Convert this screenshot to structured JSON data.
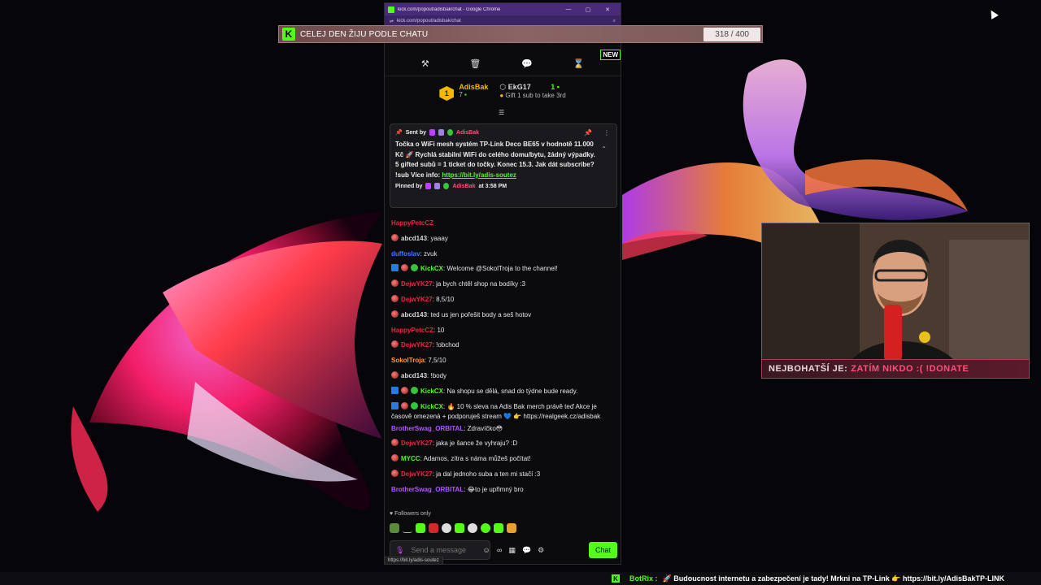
{
  "browser": {
    "window_title": "kick.com/popout/adisbak/chat - Google Chrome",
    "url": "kick.com/popout/adisbak/chat",
    "status_url": "https://bit.ly/adis-soutez"
  },
  "goal": {
    "text": "CELEJ DEN ŽIJU PODLE CHATU",
    "count": "318 / 400"
  },
  "toolbar": {
    "new_badge": "NEW"
  },
  "leaderboard": {
    "rank1": "1",
    "first_name": "AdisBak",
    "first_count": "7",
    "second_name": "EkG17",
    "second_count": "1",
    "second_hint": "Gift 1 sub to take 3rd"
  },
  "pinned": {
    "sent_by": "Sent by",
    "sender": "AdisBak",
    "body": "Točka o WiFi mesh systém TP-Link Deco BE65 v hodnotě 11.000 Kč 🚀 Rychlá stabilní WiFi do celého domu/bytu, žádný výpadky. 5 gifted subů = 1 ticket do točky. Konec 15.3. Jak dát subscribe? !sub Více info: ",
    "link": "https://bit.ly/adis-soutez",
    "pinned_by": "Pinned by",
    "pinner": "AdisBak",
    "time": "at 3:58 PM"
  },
  "chat": [
    {
      "user": "HappyPetcCZ",
      "color": "#e8263f",
      "text": "",
      "badge": ""
    },
    {
      "user": "abcd143",
      "color": "#d9d9d9",
      "text": ": yaaay",
      "badge": "red"
    },
    {
      "user": "duffoslav",
      "color": "#3d7bff",
      "text": ": zvuk",
      "badge": ""
    },
    {
      "user": "KickCX",
      "color": "#53fc18",
      "text": ": Welcome @SokolTroja to the channel!",
      "badge": "bot"
    },
    {
      "user": "DejwYK27",
      "color": "#e8263f",
      "text": ": ja bych chtěl shop na bodíky :3",
      "badge": "red"
    },
    {
      "user": "DejwYK27",
      "color": "#e8263f",
      "text": ": 8,5/10",
      "badge": "red"
    },
    {
      "user": "abcd143",
      "color": "#d9d9d9",
      "text": ": ted us jen pořešit body a seš hotov",
      "badge": "red"
    },
    {
      "user": "HappyPetcCZ",
      "color": "#e8263f",
      "text": ": 10",
      "badge": ""
    },
    {
      "user": "DejwYK27",
      "color": "#e8263f",
      "text": ": !obchod",
      "badge": "red"
    },
    {
      "user": "SokolTroja",
      "color": "#ff9d2e",
      "text": ": 7,5/10",
      "badge": ""
    },
    {
      "user": "abcd143",
      "color": "#d9d9d9",
      "text": ": !body",
      "badge": "red"
    },
    {
      "user": "KickCX",
      "color": "#53fc18",
      "text": ": Na shopu se dělá, snad do týdne bude ready.",
      "badge": "bot"
    },
    {
      "user": "KickCX",
      "color": "#53fc18",
      "text": ": 🔥 10 % sleva na Adis Bak merch právě teď Akce je časově omezená + podporuješ stream 💙 👉 https://realgeek.cz/adisbak",
      "badge": "bot",
      "tall": true
    },
    {
      "user": "BrotherSwag_ORBITAL",
      "color": "#b256ff",
      "text": ": Zdravíčko😳",
      "badge": ""
    },
    {
      "user": "DejwYK27",
      "color": "#e8263f",
      "text": ": jaka je šance že vyhraju? :D",
      "badge": "red"
    },
    {
      "user": "MYCC",
      "color": "#53fc18",
      "text": ": Adamos, zítra s náma můžeš počítat!",
      "badge": "red"
    },
    {
      "user": "DejwYK27",
      "color": "#e8263f",
      "text": ": ja dal jednoho suba a ten mi stačí :3",
      "badge": "red"
    },
    {
      "user": "BrotherSwag_ORBITAL",
      "color": "#b256ff",
      "text": ": 😂to je upřimný bro",
      "badge": ""
    }
  ],
  "followers_only": "Followers only",
  "input": {
    "placeholder": "Send a message",
    "chat_button": "Chat"
  },
  "webcam_bar": {
    "label": "NEJBOHATŠÍ JE:",
    "value": "ZATÍM NIKDO :( !DONATE"
  },
  "ticker": {
    "bot": "BotRix :",
    "text": "🚀 Budoucnost internetu a zabezpečení je tady! Mrkni na TP-Link 👉 https://bit.ly/AdisBakTP-LINK"
  },
  "colors": {
    "accent": "#53fc18",
    "window": "#4a2b7a"
  }
}
